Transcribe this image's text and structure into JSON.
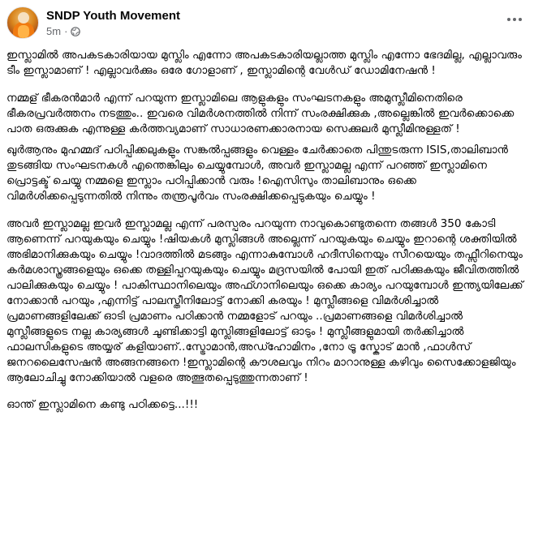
{
  "post": {
    "page_name": "SNDP Youth Movement",
    "timestamp": "5m",
    "separator": "·",
    "privacy_icon": "globe-icon",
    "more_icon": "more-options-icon",
    "paragraphs": [
      "ഇസ്ലാമിൽ അപകടകാരിയായ മുസ്ലിം എന്നോ അപകടകാരിയല്ലാത്ത മുസ്ലിം എന്നോ ഭേദമില്ല, എല്ലാവരും ടീം ഇസ്ലാമാണ് ! എല്ലാവർക്കും ഒരേ ഗോളാണ് , ഇസ്ലാമിന്റെ വേൾഡ് ഡോമിനേഷൻ !",
      "നമ്മള് ഭീകരൻമാർ എന്ന് പറയുന്ന ഇസ്ലാമിലെ ആളുകളും സംഘടനകളും അമുസ്ലീമിനെതിരെ ഭീകരപ്രവർത്തനം നടത്തും.. ഇവരെ വിമർശനത്തിൽ നിന്ന് സംരക്ഷിക്കുക ,അല്ലെങ്കിൽ ഇവർക്കൊക്കെ പാത ഒരുക്കുക എന്നുള്ള കർത്തവ്യമാണ് സാധാരണക്കാരനായ സെക്കുലർ മുസ്ലീമിനുള്ളത് !",
      "ഖുർആനും മുഹമ്മദ് പഠിപ്പിക്കലുകളും സങ്കൽപ്പങ്ങളും വെള്ളം ചേർക്കാതെ പിന്തുടരുന്ന ISIS,താലിബാൻ തുടങ്ങിയ സംഘടനകൾ എന്തെങ്കിലും ചെയ്യുമ്പോൾ, അവർ ഇസ്ലാമല്ല എന്ന് പറഞ്ഞ് ഇസ്ലാമിനെ പ്രൊട്ടക്ട് ചെയ്യു നമ്മളെ ഇസ്ലാം പഠിപ്പിക്കാൻ വരും !ഐസിസും താലിബാനും ഒക്കെ വിമർശിക്കപ്പെടുന്നതിൽ നിന്നും തന്ത്രപൂർവം സംരക്ഷിക്കപ്പെടുകയും ചെയ്യും !",
      "അവർ ഇസ്ലാമല്ല ഇവർ ഇസ്ലാമല്ല എന്ന് പരസ്പരം പറയുന്ന നാവുകൊണ്ടുതന്നെ തങ്ങൾ 350 കോടി ആണെന്ന് പറയുകയും ചെയ്യും !ഷിയകൾ മുസ്ലിങ്ങൾ അല്ലെന്ന് പറയുകയും ചെയ്യും ഇറാന്റെ ശക്തിയിൽ അഭിമാനിക്കുകയും ചെയ്യും !വാദത്തിൽ മടങ്ങും എന്നാകുമ്പോൾ ഹദീസിനെയും സീറയെയും തഫ്സീറിനെയും കർമശാസ്ത്രങ്ങളെയും ഒക്കെ തള്ളിപ്പറയുകയും ചെയ്യും മദ്രസയിൽ പോയി ഇത് പഠിക്കുകയും ജീവിതത്തിൽ പാലിക്കുകയും ചെയ്യും ! പാകിസ്ഥാനിലെയും അഫ്ഗാനിലെയും ഒക്കെ കാര്യം പറയുമ്പോൾ ഇന്ത്യയിലേക്ക് നോക്കാൻ പറയും ,എന്നിട്ട് പാലസ്തീനിലോട്ട് നോക്കി കരയും ! മുസ്ലീങ്ങളെ വിമർശിച്ചാൽ പ്രമാണങ്ങളിലേക്ക് ഓടി പ്രമാണം പഠിക്കാൻ നമ്മളോട് പറയും ..പ്രമാണങ്ങളെ വിമർശിച്ചാൽ മുസ്ലീങ്ങളുടെ നല്ല കാര്യങ്ങൾ ചൂണ്ടിക്കാട്ടി മുസ്ലിങ്ങളിലോട്ട് ഓടും ! മുസ്ലീങ്ങളുമായി തർക്കിച്ചാൽ ഫാലസികളുടെ അയ്യര് കളിയാണ്..സ്ട്രോമാൻ,അഡ്ഹോമിനം ,നോ ട്രൂ സ്കോട് മാൻ ,ഫാൾസ് ജനറലൈസേഷൻ അങ്ങനങ്ങനെ !ഇസ്ലാമിന്റെ കൗശലവും നിറം മാറാനുള്ള കഴിവും സൈക്കോളജിയും ആലോചിച്ചു നോക്കിയാൽ വളരെ അത്ഭുതപ്പെടുത്തുന്നതാണ് !",
      "ഓന്ത് ഇസ്ലാമിനെ കണ്ടു പഠിക്കട്ടെ...!!!"
    ]
  }
}
